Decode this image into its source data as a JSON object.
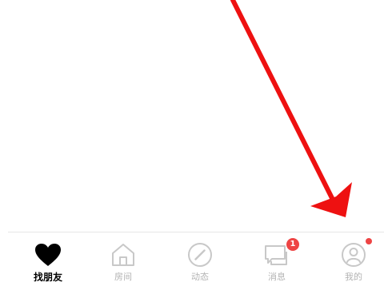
{
  "tabbar": {
    "tabs": [
      {
        "label": "找朋友",
        "icon": "heart-icon",
        "active": true
      },
      {
        "label": "房间",
        "icon": "house-icon",
        "active": false
      },
      {
        "label": "动态",
        "icon": "compass-icon",
        "active": false
      },
      {
        "label": "消息",
        "icon": "chat-bubbles-icon",
        "active": false,
        "badge": "1"
      },
      {
        "label": "我的",
        "icon": "profile-icon",
        "active": false,
        "dot": true
      }
    ]
  },
  "colors": {
    "active": "#000000",
    "inactive": "#b3b3b3",
    "badge": "#ee4444",
    "annotation_arrow": "#ee1111"
  }
}
